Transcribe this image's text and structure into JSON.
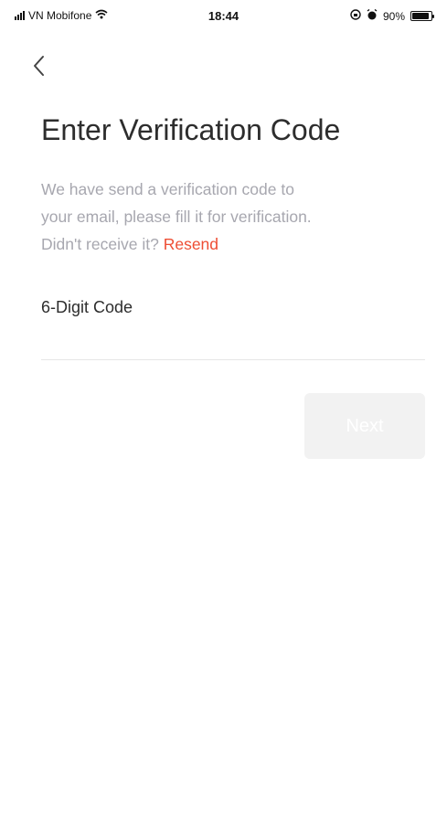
{
  "status_bar": {
    "carrier": "VN Mobifone",
    "time": "18:44",
    "battery": "90%",
    "battery_level": 0.9
  },
  "title": "Enter Verification Code",
  "description": {
    "line1": "We have send a verification code to",
    "line2": "your email, please fill it for verification.",
    "line3_prefix": "Didn't receive it?",
    "resend_label": "Resend"
  },
  "code_field": {
    "label": "6-Digit Code",
    "value": "",
    "placeholder": ""
  },
  "next_label": "Next",
  "colors": {
    "accent": "#ee4e34",
    "muted_text": "#a7a7af",
    "disabled_button": "#f2f2f2"
  },
  "icons": {
    "back": "chevron-left-icon",
    "signal": "cellular-signal-icon",
    "wifi": "wifi-icon",
    "lock": "orientation-lock-icon",
    "alarm": "alarm-icon",
    "battery": "battery-icon"
  }
}
